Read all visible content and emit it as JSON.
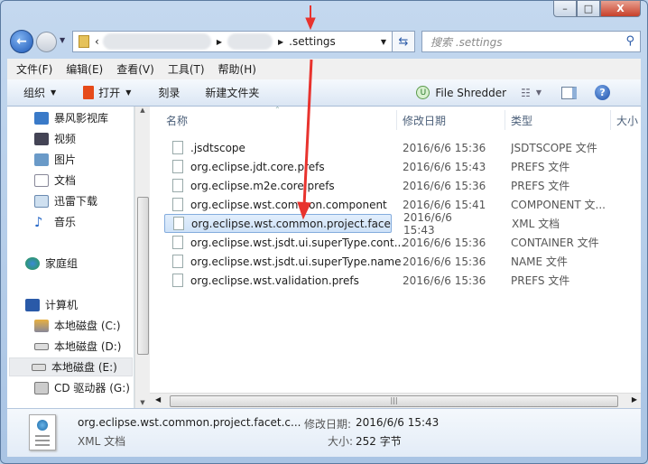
{
  "window": {
    "min": "–",
    "max": "□",
    "close": "X"
  },
  "address": {
    "current": ".settings",
    "search_placeholder": "搜索 .settings"
  },
  "menu": [
    "文件(F)",
    "编辑(E)",
    "查看(V)",
    "工具(T)",
    "帮助(H)"
  ],
  "toolbar": {
    "organize": "组织",
    "open": "打开",
    "burn": "刻录",
    "new_folder": "新建文件夹",
    "file_shredder": "File Shredder"
  },
  "sidebar": {
    "items": [
      {
        "label": "暴风影视库",
        "icon": "video-library-icon"
      },
      {
        "label": "视频",
        "icon": "video-icon"
      },
      {
        "label": "图片",
        "icon": "pictures-icon"
      },
      {
        "label": "文档",
        "icon": "documents-icon"
      },
      {
        "label": "迅雷下载",
        "icon": "download-icon"
      },
      {
        "label": "音乐",
        "icon": "music-icon"
      },
      {
        "label": "家庭组",
        "icon": "homegroup-icon"
      },
      {
        "label": "计算机",
        "icon": "computer-icon"
      },
      {
        "label": "本地磁盘 (C:)",
        "icon": "drive-icon"
      },
      {
        "label": "本地磁盘 (D:)",
        "icon": "drive-icon"
      },
      {
        "label": "本地磁盘 (E:)",
        "icon": "drive-icon",
        "selected": true
      },
      {
        "label": "CD 驱动器 (G:)",
        "icon": "cd-drive-icon"
      }
    ]
  },
  "columns": {
    "name": "名称",
    "date": "修改日期",
    "type": "类型",
    "size": "大小"
  },
  "files": [
    {
      "name": ".jsdtscope",
      "date": "2016/6/6 15:36",
      "type": "JSDTSCOPE 文件"
    },
    {
      "name": "org.eclipse.jdt.core.prefs",
      "date": "2016/6/6 15:43",
      "type": "PREFS 文件"
    },
    {
      "name": "org.eclipse.m2e.core.prefs",
      "date": "2016/6/6 15:36",
      "type": "PREFS 文件"
    },
    {
      "name": "org.eclipse.wst.common.component",
      "date": "2016/6/6 15:41",
      "type": "COMPONENT 文..."
    },
    {
      "name": "org.eclipse.wst.common.project.facet...",
      "date": "2016/6/6 15:43",
      "type": "XML 文档",
      "selected": true
    },
    {
      "name": "org.eclipse.wst.jsdt.ui.superType.cont...",
      "date": "2016/6/6 15:36",
      "type": "CONTAINER 文件"
    },
    {
      "name": "org.eclipse.wst.jsdt.ui.superType.name",
      "date": "2016/6/6 15:36",
      "type": "NAME 文件"
    },
    {
      "name": "org.eclipse.wst.validation.prefs",
      "date": "2016/6/6 15:36",
      "type": "PREFS 文件"
    }
  ],
  "details": {
    "name": "org.eclipse.wst.common.project.facet.c...",
    "type": "XML 文档",
    "date_label": "修改日期:",
    "date": "2016/6/6 15:43",
    "size_label": "大小:",
    "size": "252 字节"
  },
  "colors": {
    "annotation_arrow": "#e8332e",
    "selection": "#cfe2f8"
  }
}
